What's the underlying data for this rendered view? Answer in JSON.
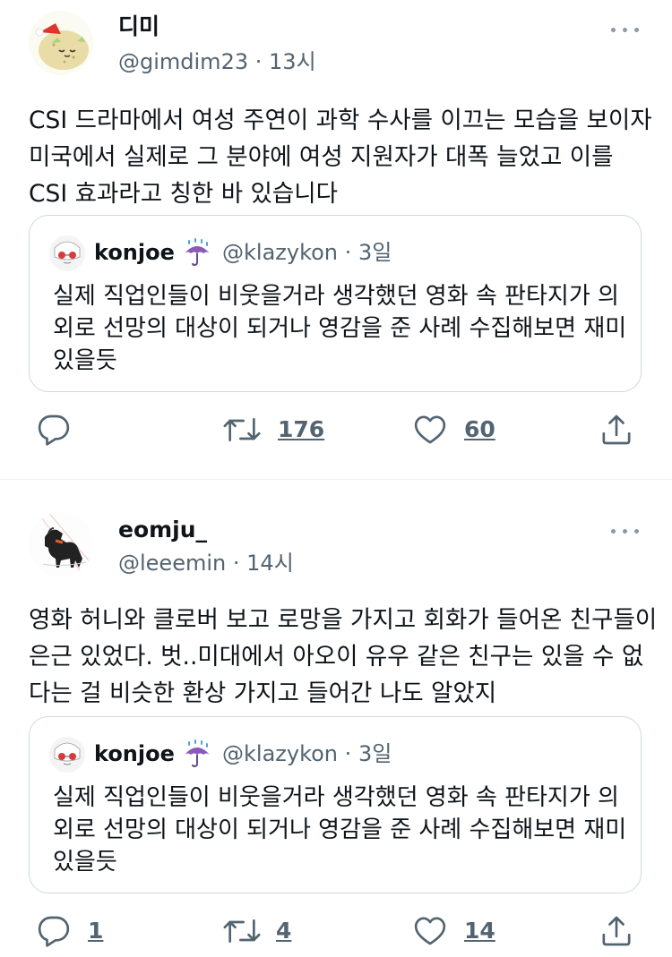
{
  "tweets": [
    {
      "author_name": "디미",
      "author_handle": "@gimdim23",
      "time": "13시",
      "text_lines": [
        "CSI 드라마에서 여성 주연이 과학 수사를 이끄는 모습을 보이자",
        "미국에서 실제로 그 분야에 여성 지원자가 대폭 늘었고 이를",
        "CSI 효과라고 칭한 바 있습니다"
      ],
      "quote": {
        "author_name": "konjoe",
        "author_handle": "@klazykon",
        "time": "3일",
        "text_lines": [
          "실제 직업인들이 비웃을거라 생각했던 영화 속 판타지가 의",
          "외로 선망의 대상이 되거나 영감을 준 사례 수집해보면 재미",
          "있을듯"
        ]
      },
      "actions": {
        "reply": "",
        "retweet": "176",
        "like": "60"
      }
    },
    {
      "author_name": "eomju_",
      "author_handle": "@leeemin",
      "time": "14시",
      "text_lines": [
        "영화 허니와 클로버 보고 로망을 가지고 회화가 들어온 친구들이",
        "은근 있었다. 벗..미대에서 아오이 유우 같은 친구는 있을 수 없",
        "다는 걸 비슷한 환상 가지고 들어간 나도 알았지"
      ],
      "quote": {
        "author_name": "konjoe",
        "author_handle": "@klazykon",
        "time": "3일",
        "text_lines": [
          "실제 직업인들이 비웃을거라 생각했던 영화 속 판타지가 의",
          "외로 선망의 대상이 되거나 영감을 준 사례 수집해보면 재미",
          "있을듯"
        ]
      },
      "actions": {
        "reply": "1",
        "retweet": "4",
        "like": "14"
      }
    }
  ],
  "separator": "·",
  "icons": {
    "reply": "reply-icon",
    "retweet": "retweet-icon",
    "like": "heart-icon",
    "share": "share-icon",
    "more": "more-icon",
    "quote_emoji": "umbrella-with-rain-icon"
  },
  "colors": {
    "text": "#0f1419",
    "secondary": "#536471",
    "border": "#cfd9de",
    "divider": "#eff3f4"
  }
}
